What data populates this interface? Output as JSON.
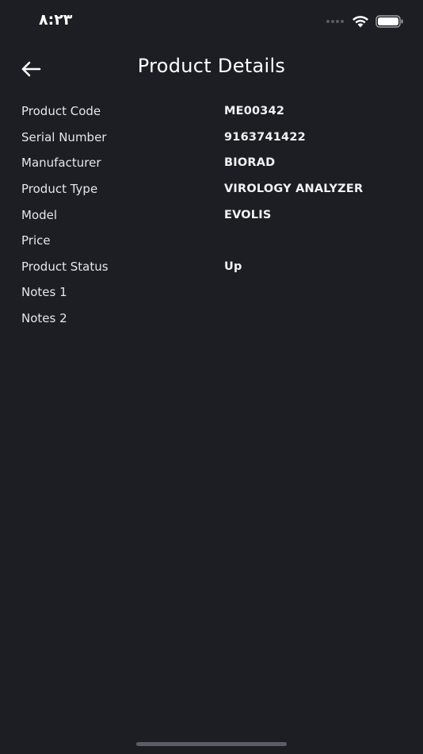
{
  "status_bar": {
    "time": "٨:٢٣",
    "icons": [
      "signal-dots-icon",
      "wifi-icon",
      "battery-icon"
    ]
  },
  "header": {
    "title": "Product Details",
    "back_icon": "arrow-left-icon"
  },
  "details": [
    {
      "label": "Product Code",
      "value": "ME00342"
    },
    {
      "label": "Serial Number",
      "value": "9163741422"
    },
    {
      "label": "Manufacturer",
      "value": "BIORAD"
    },
    {
      "label": "Product Type",
      "value": "VIROLOGY ANALYZER"
    },
    {
      "label": "Model",
      "value": "EVOLIS"
    },
    {
      "label": "Price",
      "value": ""
    },
    {
      "label": "Product Status",
      "value": "Up"
    },
    {
      "label": "Notes 1",
      "value": ""
    },
    {
      "label": "Notes 2",
      "value": ""
    }
  ],
  "colors": {
    "background": "#1c1e24",
    "text": "#ffffff",
    "home_indicator": "#5b5e66"
  }
}
